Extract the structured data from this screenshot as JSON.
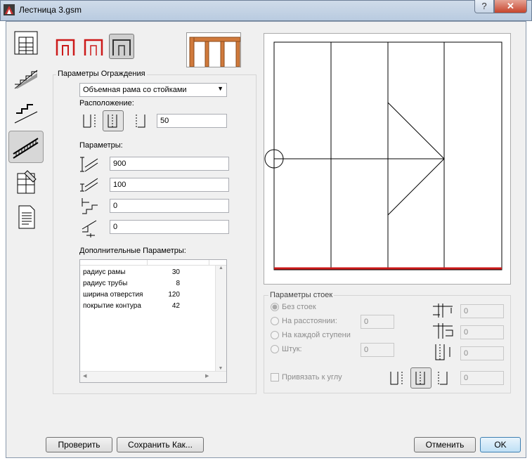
{
  "window": {
    "title": "Лестница 3.gsm",
    "help": "?",
    "close": "✕"
  },
  "tabs": [
    {
      "name": "plan-view"
    },
    {
      "name": "stair-section"
    },
    {
      "name": "stair-profile"
    },
    {
      "name": "railing",
      "active": true
    },
    {
      "name": "materials"
    },
    {
      "name": "listing"
    }
  ],
  "railing": {
    "group_title": "Параметры Ограждения",
    "type_value": "Объемная рама со стойками",
    "placement_label": "Расположение:",
    "placement_value": "50",
    "params_label": "Параметры:",
    "params": [
      "900",
      "100",
      "0",
      "0"
    ],
    "extra_label": "Дополнительные Параметры:",
    "extra_rows": [
      {
        "name": "радиус рамы",
        "value": "30"
      },
      {
        "name": "радиус трубы",
        "value": "8"
      },
      {
        "name": "ширина отверстия",
        "value": "120"
      },
      {
        "name": "покрытие контура",
        "value": "42"
      }
    ]
  },
  "posts": {
    "group_title": "Параметры стоек",
    "options": [
      {
        "label": "Без стоек",
        "selected": true
      },
      {
        "label": "На расстоянии:",
        "value": "0"
      },
      {
        "label": "На каждой ступени"
      },
      {
        "label": "Штук:",
        "value": "0"
      }
    ],
    "snap_label": "Привязать к углу",
    "right_values": [
      "0",
      "0",
      "0",
      "0"
    ]
  },
  "buttons": {
    "check": "Проверить",
    "save_as": "Сохранить Как...",
    "cancel": "Отменить",
    "ok": "OK"
  },
  "colors": {
    "accent_red": "#cc1a1a",
    "ok_border": "#3c7fb1"
  }
}
